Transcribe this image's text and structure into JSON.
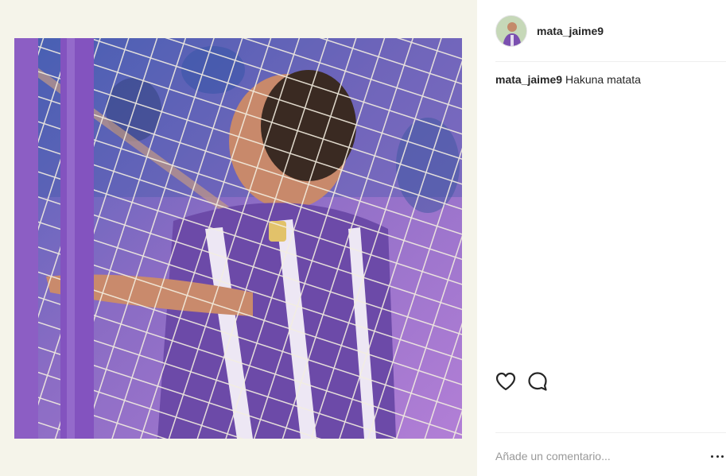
{
  "post": {
    "username": "mata_jaime9",
    "caption_user": "mata_jaime9",
    "caption_text": "Hakuna matata",
    "photo_icon": "photo-football-player-in-goal-net"
  },
  "actions": {
    "like_icon": "heart-icon",
    "comment_icon": "comment-bubble-icon"
  },
  "comment_box": {
    "placeholder": "Añade un comentario..."
  },
  "colors": {
    "media_background": "#f5f4ea",
    "text": "#262626",
    "placeholder": "#999999",
    "divider": "#efefef",
    "kit_purple": "#7a4fb0"
  }
}
